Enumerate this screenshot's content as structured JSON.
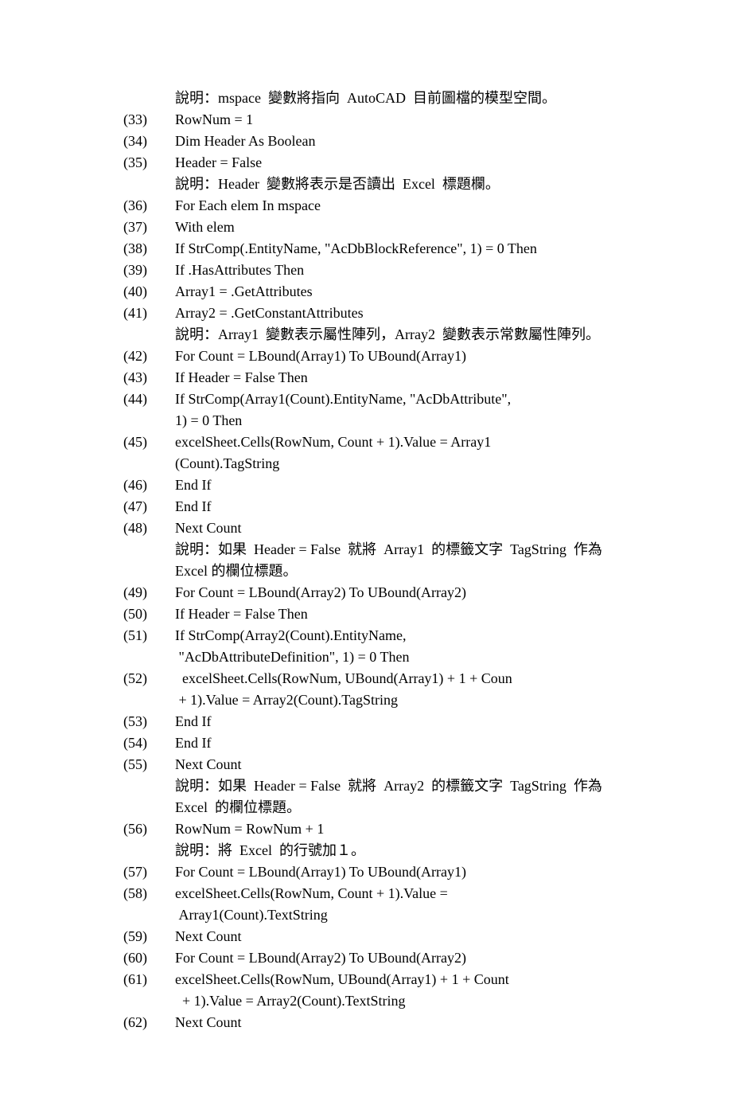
{
  "lines": [
    {
      "num": "",
      "text": "說明：mspace  變數將指向  AutoCAD  目前圖檔的模型空間。",
      "indent": true
    },
    {
      "num": "(33)",
      "text": "RowNum = 1"
    },
    {
      "num": "(34)",
      "text": "Dim Header As Boolean"
    },
    {
      "num": "(35)",
      "text": "Header = False"
    },
    {
      "num": "",
      "text": "說明：Header  變數將表示是否讀出  Excel  標題欄。",
      "indent": true
    },
    {
      "num": "(36)",
      "text": "For Each elem In mspace"
    },
    {
      "num": "(37)",
      "text": "With elem"
    },
    {
      "num": "(38)",
      "text": "If StrComp(.EntityName, \"AcDbBlockReference\", 1) = 0 Then"
    },
    {
      "num": "(39)",
      "text": "If .HasAttributes Then"
    },
    {
      "num": "(40)",
      "text": "Array1 = .GetAttributes"
    },
    {
      "num": "(41)",
      "text": "Array2 = .GetConstantAttributes"
    },
    {
      "num": "",
      "text": "說明：Array1  變數表示屬性陣列，Array2  變數表示常數屬性陣列。",
      "indent": true
    },
    {
      "num": "(42)",
      "text": "For Count = LBound(Array1) To UBound(Array1)"
    },
    {
      "num": "(43)",
      "text": "If Header = False Then"
    },
    {
      "num": "(44)",
      "text": "If StrComp(Array1(Count).EntityName, \"AcDbAttribute\","
    },
    {
      "num": "",
      "text": "1) = 0 Then",
      "indent": true
    },
    {
      "num": "(45)",
      "text": "excelSheet.Cells(RowNum, Count + 1).Value = Array1"
    },
    {
      "num": "",
      "text": "(Count).TagString",
      "indent": true
    },
    {
      "num": "(46)",
      "text": "End If"
    },
    {
      "num": "(47)",
      "text": "End If"
    },
    {
      "num": "(48)",
      "text": "Next Count"
    },
    {
      "num": "",
      "text": "說明：如果  Header = False  就將  Array1  的標籤文字  TagString  作為",
      "indent": true
    },
    {
      "num": "",
      "text": "Excel 的欄位標題。",
      "indent": true
    },
    {
      "num": "(49)",
      "text": "For Count = LBound(Array2) To UBound(Array2)"
    },
    {
      "num": "(50)",
      "text": "If Header = False Then"
    },
    {
      "num": "(51)",
      "text": "If StrComp(Array2(Count).EntityName,"
    },
    {
      "num": "",
      "text": " \"AcDbAttributeDefinition\", 1) = 0 Then",
      "indent": true
    },
    {
      "num": "(52)",
      "text": "  excelSheet.Cells(RowNum, UBound(Array1) + 1 + Coun"
    },
    {
      "num": "",
      "text": " + 1).Value = Array2(Count).TagString",
      "indent": true
    },
    {
      "num": "(53)",
      "text": "End If"
    },
    {
      "num": "(54)",
      "text": "End If"
    },
    {
      "num": "(55)",
      "text": "Next Count"
    },
    {
      "num": "",
      "text": "說明：如果  Header = False  就將  Array2  的標籤文字  TagString  作為",
      "indent": true
    },
    {
      "num": "",
      "text": "Excel  的欄位標題。",
      "indent": true
    },
    {
      "num": "(56)",
      "text": "RowNum = RowNum + 1"
    },
    {
      "num": "",
      "text": "說明：將  Excel  的行號加１。",
      "indent": true
    },
    {
      "num": "(57)",
      "text": "For Count = LBound(Array1) To UBound(Array1)"
    },
    {
      "num": "(58)",
      "text": "excelSheet.Cells(RowNum, Count + 1).Value ="
    },
    {
      "num": "",
      "text": " Array1(Count).TextString",
      "indent": true
    },
    {
      "num": "(59)",
      "text": "Next Count"
    },
    {
      "num": "(60)",
      "text": "For Count = LBound(Array2) To UBound(Array2)"
    },
    {
      "num": "(61)",
      "text": "excelSheet.Cells(RowNum, UBound(Array1) + 1 + Count"
    },
    {
      "num": "",
      "text": "  + 1).Value = Array2(Count).TextString",
      "indent": true
    },
    {
      "num": "(62)",
      "text": "Next Count"
    }
  ]
}
